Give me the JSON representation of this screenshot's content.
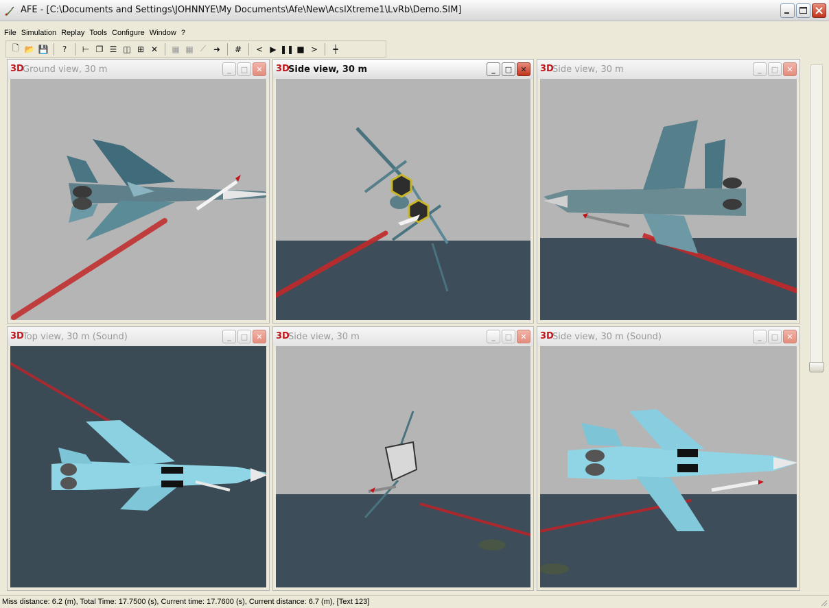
{
  "window": {
    "title": "AFE - [C:\\Documents and Settings\\JOHNNYE\\My Documents\\Afe\\New\\AcslXtreme1\\LvRb\\Demo.SIM]",
    "icon": "rocket-icon"
  },
  "menu": [
    "File",
    "Simulation",
    "Replay",
    "Tools",
    "Configure",
    "Window",
    "?"
  ],
  "toolbar": {
    "buttons": [
      {
        "name": "new-icon",
        "glyph": "🗋"
      },
      {
        "name": "open-icon",
        "glyph": "📂"
      },
      {
        "name": "save-icon",
        "glyph": "💾"
      },
      {
        "name": "help-icon",
        "glyph": "?"
      },
      {
        "name": "tree-icon",
        "glyph": "⊢"
      },
      {
        "name": "cascade-icon",
        "glyph": "❐"
      },
      {
        "name": "tile-horizontal-icon",
        "glyph": "☰"
      },
      {
        "name": "tile-vertical-icon",
        "glyph": "◫"
      },
      {
        "name": "arrange-icon",
        "glyph": "⊞"
      },
      {
        "name": "close-all-icon",
        "glyph": "✕"
      },
      {
        "name": "record-icon",
        "glyph": "▦"
      },
      {
        "name": "record2-icon",
        "glyph": "▦"
      },
      {
        "name": "edit-icon",
        "glyph": "⟋"
      },
      {
        "name": "export-icon",
        "glyph": "➜"
      },
      {
        "name": "grid-icon",
        "glyph": "#"
      },
      {
        "name": "step-back-icon",
        "glyph": "<"
      },
      {
        "name": "play-icon",
        "glyph": "▶"
      },
      {
        "name": "pause-icon",
        "glyph": "❚❚"
      },
      {
        "name": "stop-icon",
        "glyph": "■"
      },
      {
        "name": "step-forward-icon",
        "glyph": ">"
      },
      {
        "name": "marker-icon",
        "glyph": "┿"
      }
    ]
  },
  "views": [
    {
      "title": "Ground view, 30 m",
      "active": false
    },
    {
      "title": "Side view, 30 m",
      "active": true
    },
    {
      "title": "Side view, 30 m",
      "active": false
    },
    {
      "title": "Top view, 30 m (Sound)",
      "active": false
    },
    {
      "title": "Side view, 30 m",
      "active": false
    },
    {
      "title": "Side view, 30 m (Sound)",
      "active": false
    }
  ],
  "view_badge": "3D",
  "status": "Miss distance: 6.2 (m), Total Time: 17.7500 (s), Current time: 17.7600 (s), Current distance: 6.7 (m), [Text 123]"
}
